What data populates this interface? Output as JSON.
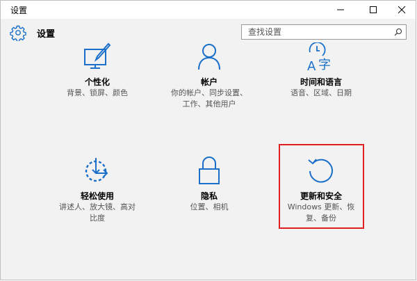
{
  "window": {
    "title": "设置"
  },
  "header": {
    "title": "设置"
  },
  "search": {
    "placeholder": "查找设置"
  },
  "colors": {
    "accent": "#1a6fc9",
    "highlight": "#e02020"
  },
  "tiles": [
    {
      "label": "个性化",
      "desc": [
        "背景、锁屏、颜色"
      ],
      "icon": "personalization-icon"
    },
    {
      "label": "帐户",
      "desc": [
        "你的帐户、同步设置、",
        "工作、其他用户"
      ],
      "icon": "account-icon"
    },
    {
      "label": "时间和语言",
      "desc": [
        "语音、区域、日期"
      ],
      "icon": "time-language-icon"
    },
    {
      "label": "轻松使用",
      "desc": [
        "讲述人、放大镜、高对",
        "比度"
      ],
      "icon": "ease-of-access-icon"
    },
    {
      "label": "隐私",
      "desc": [
        "位置、相机"
      ],
      "icon": "lock-icon"
    },
    {
      "label": "更新和安全",
      "desc": [
        "Windows 更新、恢",
        "复、备份"
      ],
      "icon": "update-icon"
    }
  ]
}
